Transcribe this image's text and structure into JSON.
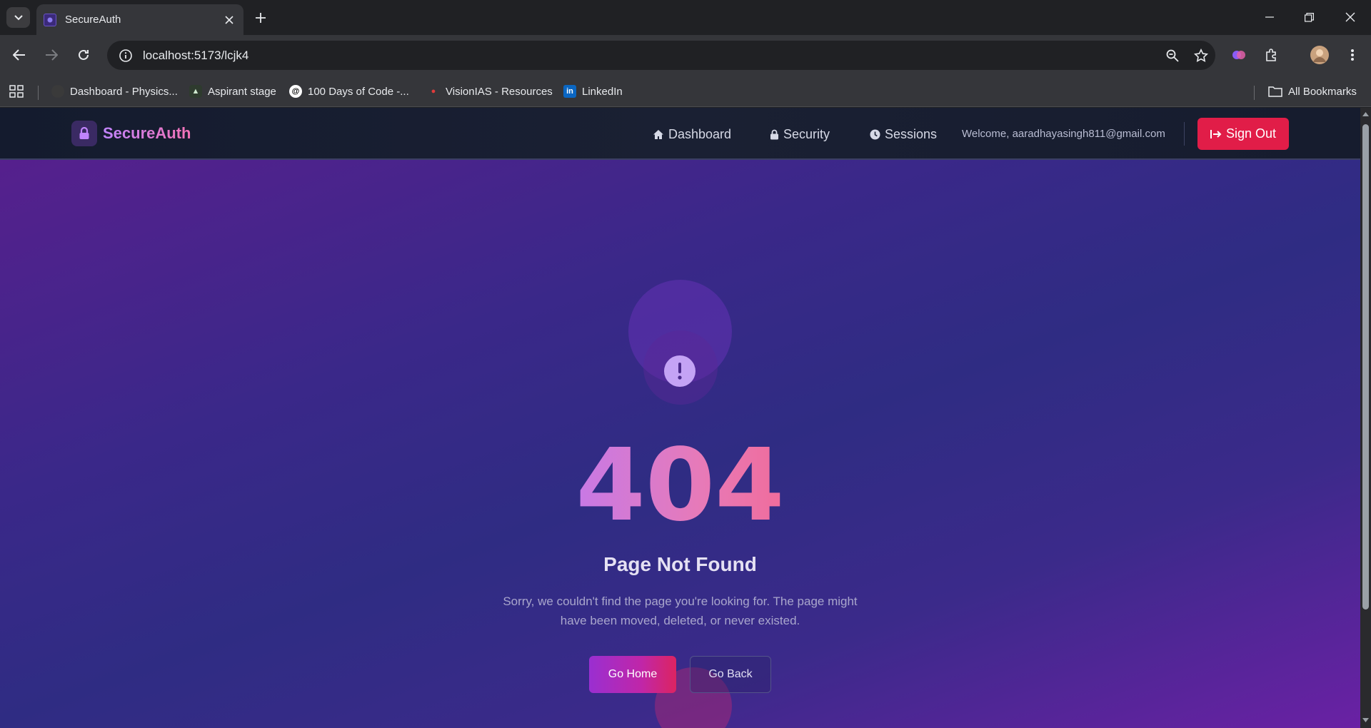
{
  "browser": {
    "tab_title": "SecureAuth",
    "url": "localhost:5173/lcjk4",
    "bookmarks": [
      {
        "label": "Dashboard - Physics..."
      },
      {
        "label": "Aspirant stage"
      },
      {
        "label": "100 Days of Code -..."
      },
      {
        "label": "VisionIAS - Resources"
      },
      {
        "label": "LinkedIn"
      }
    ],
    "all_bookmarks": "All Bookmarks"
  },
  "navbar": {
    "brand": "SecureAuth",
    "links": [
      {
        "label": "Dashboard",
        "icon": "home-icon"
      },
      {
        "label": "Security",
        "icon": "lock-icon"
      },
      {
        "label": "Sessions",
        "icon": "clock-icon"
      }
    ],
    "welcome": "Welcome, aaradhayasingh811@gmail.com",
    "sign_out": "Sign Out"
  },
  "error": {
    "code": "404",
    "title": "Page Not Found",
    "message": "Sorry, we couldn't find the page you're looking for. The page might have been moved, deleted, or never existed.",
    "primary_button": "Go Home",
    "secondary_button": "Go Back"
  },
  "colors": {
    "accent_gradient_start": "#c084fc",
    "accent_gradient_end": "#f472b6",
    "sign_out_bg": "#e11d48",
    "page_bg": "#3a2889"
  }
}
